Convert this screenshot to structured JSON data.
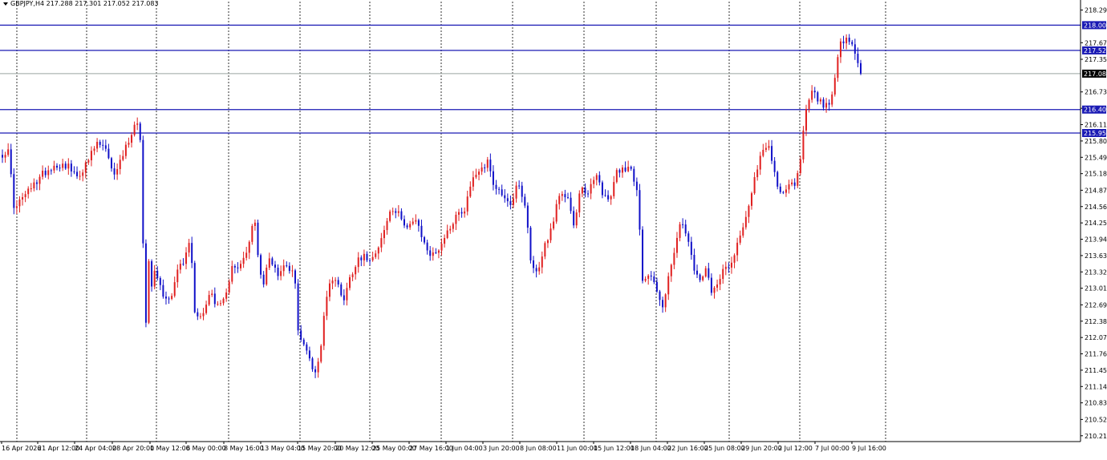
{
  "header": {
    "text": "GBPJPY,H4  217.288 217.301 217.052 217.083"
  },
  "colors": {
    "bull": "#e02020",
    "bear": "#1010c8",
    "level_line": "#1a1ab4",
    "current_line": "#9aa5a0",
    "current_label_bg": "#000000",
    "axis": "#000000",
    "vgrid": "#000000"
  },
  "chart_data": {
    "type": "candlestick",
    "symbol": "GBPJPY",
    "timeframe": "H4",
    "ohlc_header": {
      "open": 217.288,
      "high": 217.301,
      "low": 217.052,
      "close": 217.083
    },
    "ylim": [
      210.1,
      218.45
    ],
    "y_ticks": [
      218.29,
      217.67,
      217.355,
      216.736,
      216.425,
      216.115,
      215.805,
      215.495,
      215.185,
      214.87,
      214.56,
      214.25,
      213.94,
      213.63,
      213.32,
      213.01,
      212.695,
      212.385,
      212.075,
      211.765,
      211.455,
      211.145,
      210.835,
      210.52,
      210.21
    ],
    "y_tick_labels": [
      "218.290",
      "217.670",
      "217.355",
      "216.735",
      "216.425",
      "216.115",
      "215.805",
      "215.495",
      "215.185",
      "214.870",
      "214.560",
      "214.250",
      "213.940",
      "213.630",
      "213.320",
      "213.010",
      "212.695",
      "212.385",
      "212.075",
      "211.765",
      "211.455",
      "211.145",
      "210.835",
      "210.520",
      "210.210"
    ],
    "x_tick_labels": [
      "16 Apr 2026",
      "21 Apr 12:00",
      "24 Apr 04:00",
      "28 Apr 20:00",
      "1 May 12:00",
      "6 May 00:00",
      "8 May 16:00",
      "13 May 04:00",
      "15 May 20:00",
      "20 May 12:00",
      "25 May 00:00",
      "27 May 16:00",
      "1 Jun 04:00",
      "3 Jun 20:00",
      "8 Jun 08:00",
      "11 Jun 00:00",
      "15 Jun 12:00",
      "18 Jun 04:00",
      "22 Jun 16:00",
      "25 Jun 08:00",
      "29 Jun 20:00",
      "2 Jul 12:00",
      "7 Jul 00:00",
      "9 Jul 16:00"
    ],
    "horizontal_levels": [
      {
        "price": 218.003,
        "label": "218.003"
      },
      {
        "price": 217.524,
        "label": "217.524"
      },
      {
        "price": 216.401,
        "label": "216.401"
      },
      {
        "price": 215.956,
        "label": "215.956"
      }
    ],
    "current_price": {
      "price": 217.083,
      "label": "217.083"
    },
    "candle_count": 300,
    "candle_anchors": [
      [
        0,
        215.56
      ],
      [
        3,
        215.6
      ],
      [
        6,
        214.45
      ],
      [
        9,
        214.7
      ],
      [
        14,
        214.9
      ],
      [
        20,
        215.2
      ],
      [
        26,
        215.35
      ],
      [
        32,
        215.35
      ],
      [
        36,
        215.1
      ],
      [
        41,
        215.35
      ],
      [
        46,
        215.75
      ],
      [
        50,
        215.7
      ],
      [
        54,
        215.15
      ],
      [
        58,
        215.45
      ],
      [
        62,
        215.85
      ],
      [
        66,
        216.2
      ],
      [
        67,
        216.25
      ],
      [
        68,
        215.2
      ],
      [
        70,
        212.0
      ],
      [
        71,
        213.8
      ],
      [
        73,
        213.1
      ],
      [
        75,
        213.4
      ],
      [
        78,
        212.9
      ],
      [
        82,
        212.8
      ],
      [
        86,
        213.4
      ],
      [
        89,
        213.5
      ],
      [
        92,
        214.0
      ],
      [
        94,
        212.55
      ],
      [
        98,
        212.5
      ],
      [
        102,
        212.95
      ],
      [
        106,
        212.6
      ],
      [
        110,
        212.9
      ],
      [
        112,
        213.5
      ],
      [
        116,
        213.4
      ],
      [
        120,
        213.7
      ],
      [
        123,
        214.4
      ],
      [
        125,
        213.7
      ],
      [
        127,
        213.0
      ],
      [
        131,
        213.6
      ],
      [
        135,
        213.3
      ],
      [
        139,
        213.5
      ],
      [
        143,
        213.2
      ],
      [
        145,
        212.1
      ],
      [
        149,
        211.8
      ],
      [
        153,
        211.4
      ],
      [
        156,
        211.9
      ],
      [
        158,
        212.8
      ],
      [
        161,
        213.2
      ],
      [
        164,
        213.1
      ],
      [
        167,
        212.8
      ],
      [
        170,
        213.2
      ],
      [
        174,
        213.6
      ],
      [
        178,
        213.6
      ],
      [
        181,
        213.6
      ],
      [
        186,
        214.0
      ],
      [
        190,
        214.5
      ],
      [
        194,
        214.4
      ],
      [
        198,
        214.2
      ],
      [
        202,
        214.3
      ],
      [
        206,
        213.9
      ],
      [
        210,
        213.6
      ],
      [
        214,
        213.8
      ],
      [
        218,
        214.1
      ],
      [
        222,
        214.4
      ],
      [
        226,
        214.5
      ],
      [
        230,
        215.1
      ],
      [
        234,
        215.3
      ],
      [
        238,
        215.4
      ],
      [
        241,
        214.9
      ],
      [
        245,
        214.8
      ],
      [
        249,
        214.6
      ],
      [
        252,
        215.0
      ],
      [
        256,
        214.5
      ],
      [
        259,
        213.4
      ],
      [
        262,
        213.3
      ],
      [
        265,
        213.8
      ],
      [
        269,
        214.2
      ],
      [
        272,
        214.7
      ],
      [
        276,
        214.8
      ],
      [
        280,
        214.2
      ],
      [
        283,
        214.9
      ],
      [
        287,
        214.8
      ],
      [
        290,
        215.2
      ],
      [
        294,
        214.8
      ],
      [
        297,
        214.6
      ],
      [
        300,
        215.2
      ],
      [
        304,
        215.3
      ],
      [
        308,
        215.3
      ],
      [
        311,
        214.7
      ],
      [
        313,
        213.2
      ],
      [
        317,
        213.3
      ],
      [
        320,
        213.0
      ],
      [
        323,
        212.6
      ],
      [
        326,
        213.3
      ],
      [
        329,
        213.7
      ],
      [
        332,
        214.3
      ],
      [
        335,
        214.0
      ],
      [
        338,
        213.4
      ],
      [
        341,
        213.1
      ],
      [
        344,
        213.4
      ],
      [
        347,
        212.9
      ],
      [
        350,
        213.1
      ],
      [
        353,
        213.5
      ],
      [
        356,
        213.4
      ],
      [
        359,
        213.8
      ],
      [
        362,
        214.1
      ],
      [
        365,
        214.6
      ],
      [
        368,
        215.1
      ],
      [
        372,
        215.6
      ],
      [
        375,
        215.7
      ],
      [
        379,
        215.0
      ],
      [
        382,
        214.8
      ],
      [
        385,
        214.95
      ],
      [
        388,
        215.0
      ],
      [
        391,
        215.6
      ],
      [
        393,
        216.4
      ],
      [
        396,
        216.8
      ],
      [
        399,
        216.6
      ],
      [
        402,
        216.45
      ],
      [
        405,
        216.55
      ],
      [
        408,
        217.2
      ],
      [
        410,
        217.65
      ],
      [
        413,
        217.7
      ],
      [
        416,
        217.6
      ],
      [
        418,
        217.3
      ],
      [
        420,
        217.083
      ]
    ]
  }
}
